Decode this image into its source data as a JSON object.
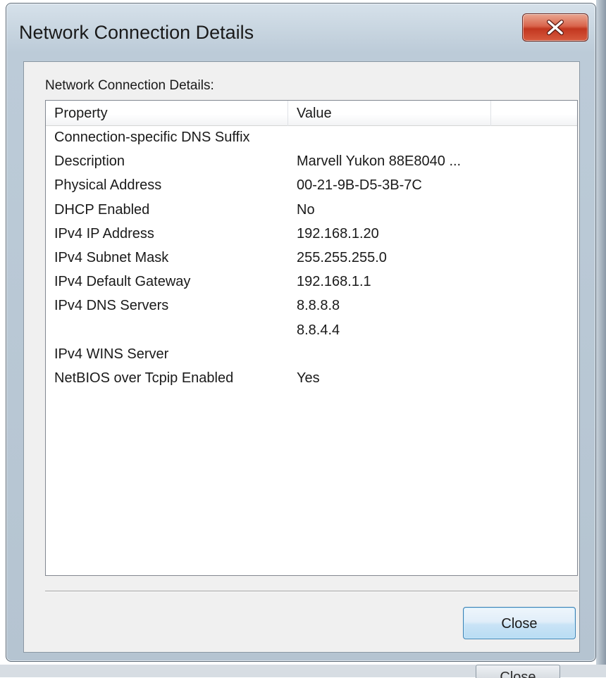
{
  "window": {
    "title": "Network Connection Details",
    "close_icon": "close-x-icon",
    "close_button_color": "#c2371f"
  },
  "dialog": {
    "section_label": "Network Connection Details:",
    "columns": [
      "Property",
      "Value",
      ""
    ],
    "rows": [
      {
        "property": "Connection-specific DNS Suffix",
        "value": ""
      },
      {
        "property": "Description",
        "value": "Marvell Yukon 88E8040 ..."
      },
      {
        "property": "Physical Address",
        "value": "00-21-9B-D5-3B-7C"
      },
      {
        "property": "DHCP Enabled",
        "value": "No"
      },
      {
        "property": "IPv4 IP Address",
        "value": "192.168.1.20"
      },
      {
        "property": "IPv4 Subnet Mask",
        "value": "255.255.255.0"
      },
      {
        "property": "IPv4 Default Gateway",
        "value": "192.168.1.1"
      },
      {
        "property": "IPv4 DNS Servers",
        "value": "8.8.8.8"
      },
      {
        "property": "",
        "value": "8.8.4.4"
      },
      {
        "property": "IPv4 WINS Server",
        "value": ""
      },
      {
        "property": "NetBIOS over Tcpip Enabled",
        "value": "Yes"
      }
    ],
    "close_label": "Close"
  },
  "background": {
    "partial_button_label": "Close"
  }
}
